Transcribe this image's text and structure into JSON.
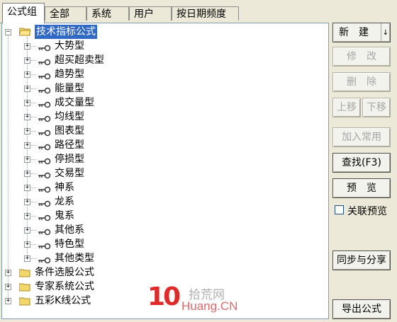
{
  "tabs": [
    "公式组",
    "全部",
    "系统",
    "用户",
    "按日期频度"
  ],
  "tree": {
    "root": "技术指标公式",
    "children": [
      "大势型",
      "超买超卖型",
      "趋势型",
      "能量型",
      "成交量型",
      "均线型",
      "图表型",
      "路径型",
      "停损型",
      "交易型",
      "神系",
      "龙系",
      "鬼系",
      "其他系",
      "特色型",
      "其他类型"
    ],
    "siblings": [
      "条件选股公式",
      "专家系统公式",
      "五彩K线公式"
    ]
  },
  "buttons": {
    "new": "新　建",
    "new_arrow": "↓",
    "modify": "修　改",
    "delete": "删　除",
    "move_up": "上移",
    "move_down": "下移",
    "add_common": "加入常用",
    "find": "查找(F3)",
    "preview": "预　览",
    "sync_share": "同步与分享",
    "export": "导出公式"
  },
  "checkbox": {
    "label": "关联预览"
  },
  "watermark": {
    "logo": "10",
    "top": "拾荒网",
    "bottom": "Huang.CN"
  },
  "colors": {
    "selection": "#316ac5",
    "disabled_text": "#a5a5a5",
    "watermark_red": "#e02a2a"
  }
}
